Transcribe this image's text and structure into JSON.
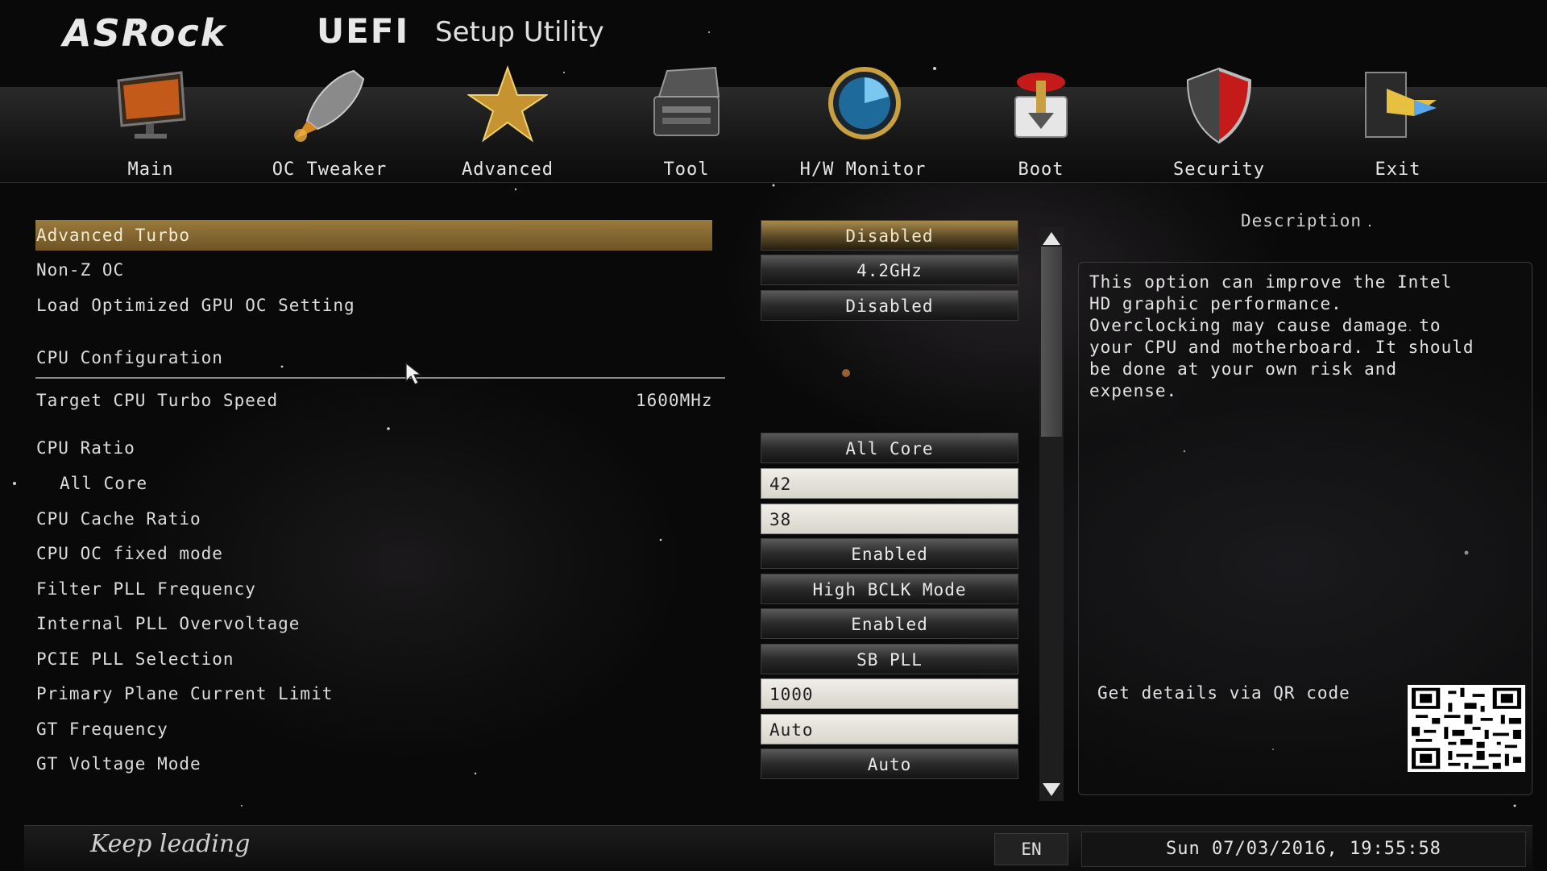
{
  "header": {
    "brand": "ASRock",
    "title_uefi": "UEFI",
    "title_setup": "Setup Utility"
  },
  "tabs": [
    {
      "label": "Main",
      "icon": "monitor-icon"
    },
    {
      "label": "OC Tweaker",
      "icon": "rocket-icon"
    },
    {
      "label": "Advanced",
      "icon": "star-icon"
    },
    {
      "label": "Tool",
      "icon": "toolbox-icon"
    },
    {
      "label": "H/W Monitor",
      "icon": "radar-icon"
    },
    {
      "label": "Boot",
      "icon": "boot-icon"
    },
    {
      "label": "Security",
      "icon": "shield-icon"
    },
    {
      "label": "Exit",
      "icon": "exit-icon"
    }
  ],
  "settings": {
    "advanced_turbo": {
      "label": "Advanced Turbo",
      "value": "Disabled"
    },
    "non_z_oc": {
      "label": "Non-Z OC",
      "value": "4.2GHz"
    },
    "gpu_oc": {
      "label": "Load Optimized GPU OC Setting",
      "value": "Disabled"
    },
    "cpu_config": {
      "label": "CPU Configuration"
    },
    "target_turbo": {
      "label": "Target CPU Turbo Speed",
      "value": "1600MHz"
    },
    "cpu_ratio": {
      "label": "CPU Ratio",
      "value": "All Core"
    },
    "all_core": {
      "label": "All Core",
      "value": "42"
    },
    "cache_ratio": {
      "label": "CPU Cache Ratio",
      "value": "38"
    },
    "oc_fixed": {
      "label": "CPU OC fixed mode",
      "value": "Enabled"
    },
    "filter_pll": {
      "label": "Filter PLL Frequency",
      "value": "High BCLK Mode"
    },
    "internal_pll": {
      "label": "Internal PLL Overvoltage",
      "value": "Enabled"
    },
    "pcie_pll": {
      "label": "PCIE PLL Selection",
      "value": "SB PLL"
    },
    "primary_plane": {
      "label": "Primary Plane Current Limit",
      "value": "1000"
    },
    "gt_freq": {
      "label": "GT Frequency",
      "value": "Auto"
    },
    "gt_voltage": {
      "label": "GT Voltage Mode",
      "value": "Auto"
    }
  },
  "description": {
    "title": "Description",
    "lines": [
      "This option can improve the Intel",
      "HD graphic performance.",
      "Overclocking may cause damage to",
      "your CPU and motherboard. It should",
      "be done at your own risk and",
      "expense."
    ],
    "qr_text": "Get details via QR code"
  },
  "footer": {
    "slogan": "Keep leading",
    "language": "EN",
    "datetime": "Sun 07/03/2016, 19:55:58"
  },
  "colors": {
    "selection": "#9a7b3d",
    "background": "#090909"
  }
}
